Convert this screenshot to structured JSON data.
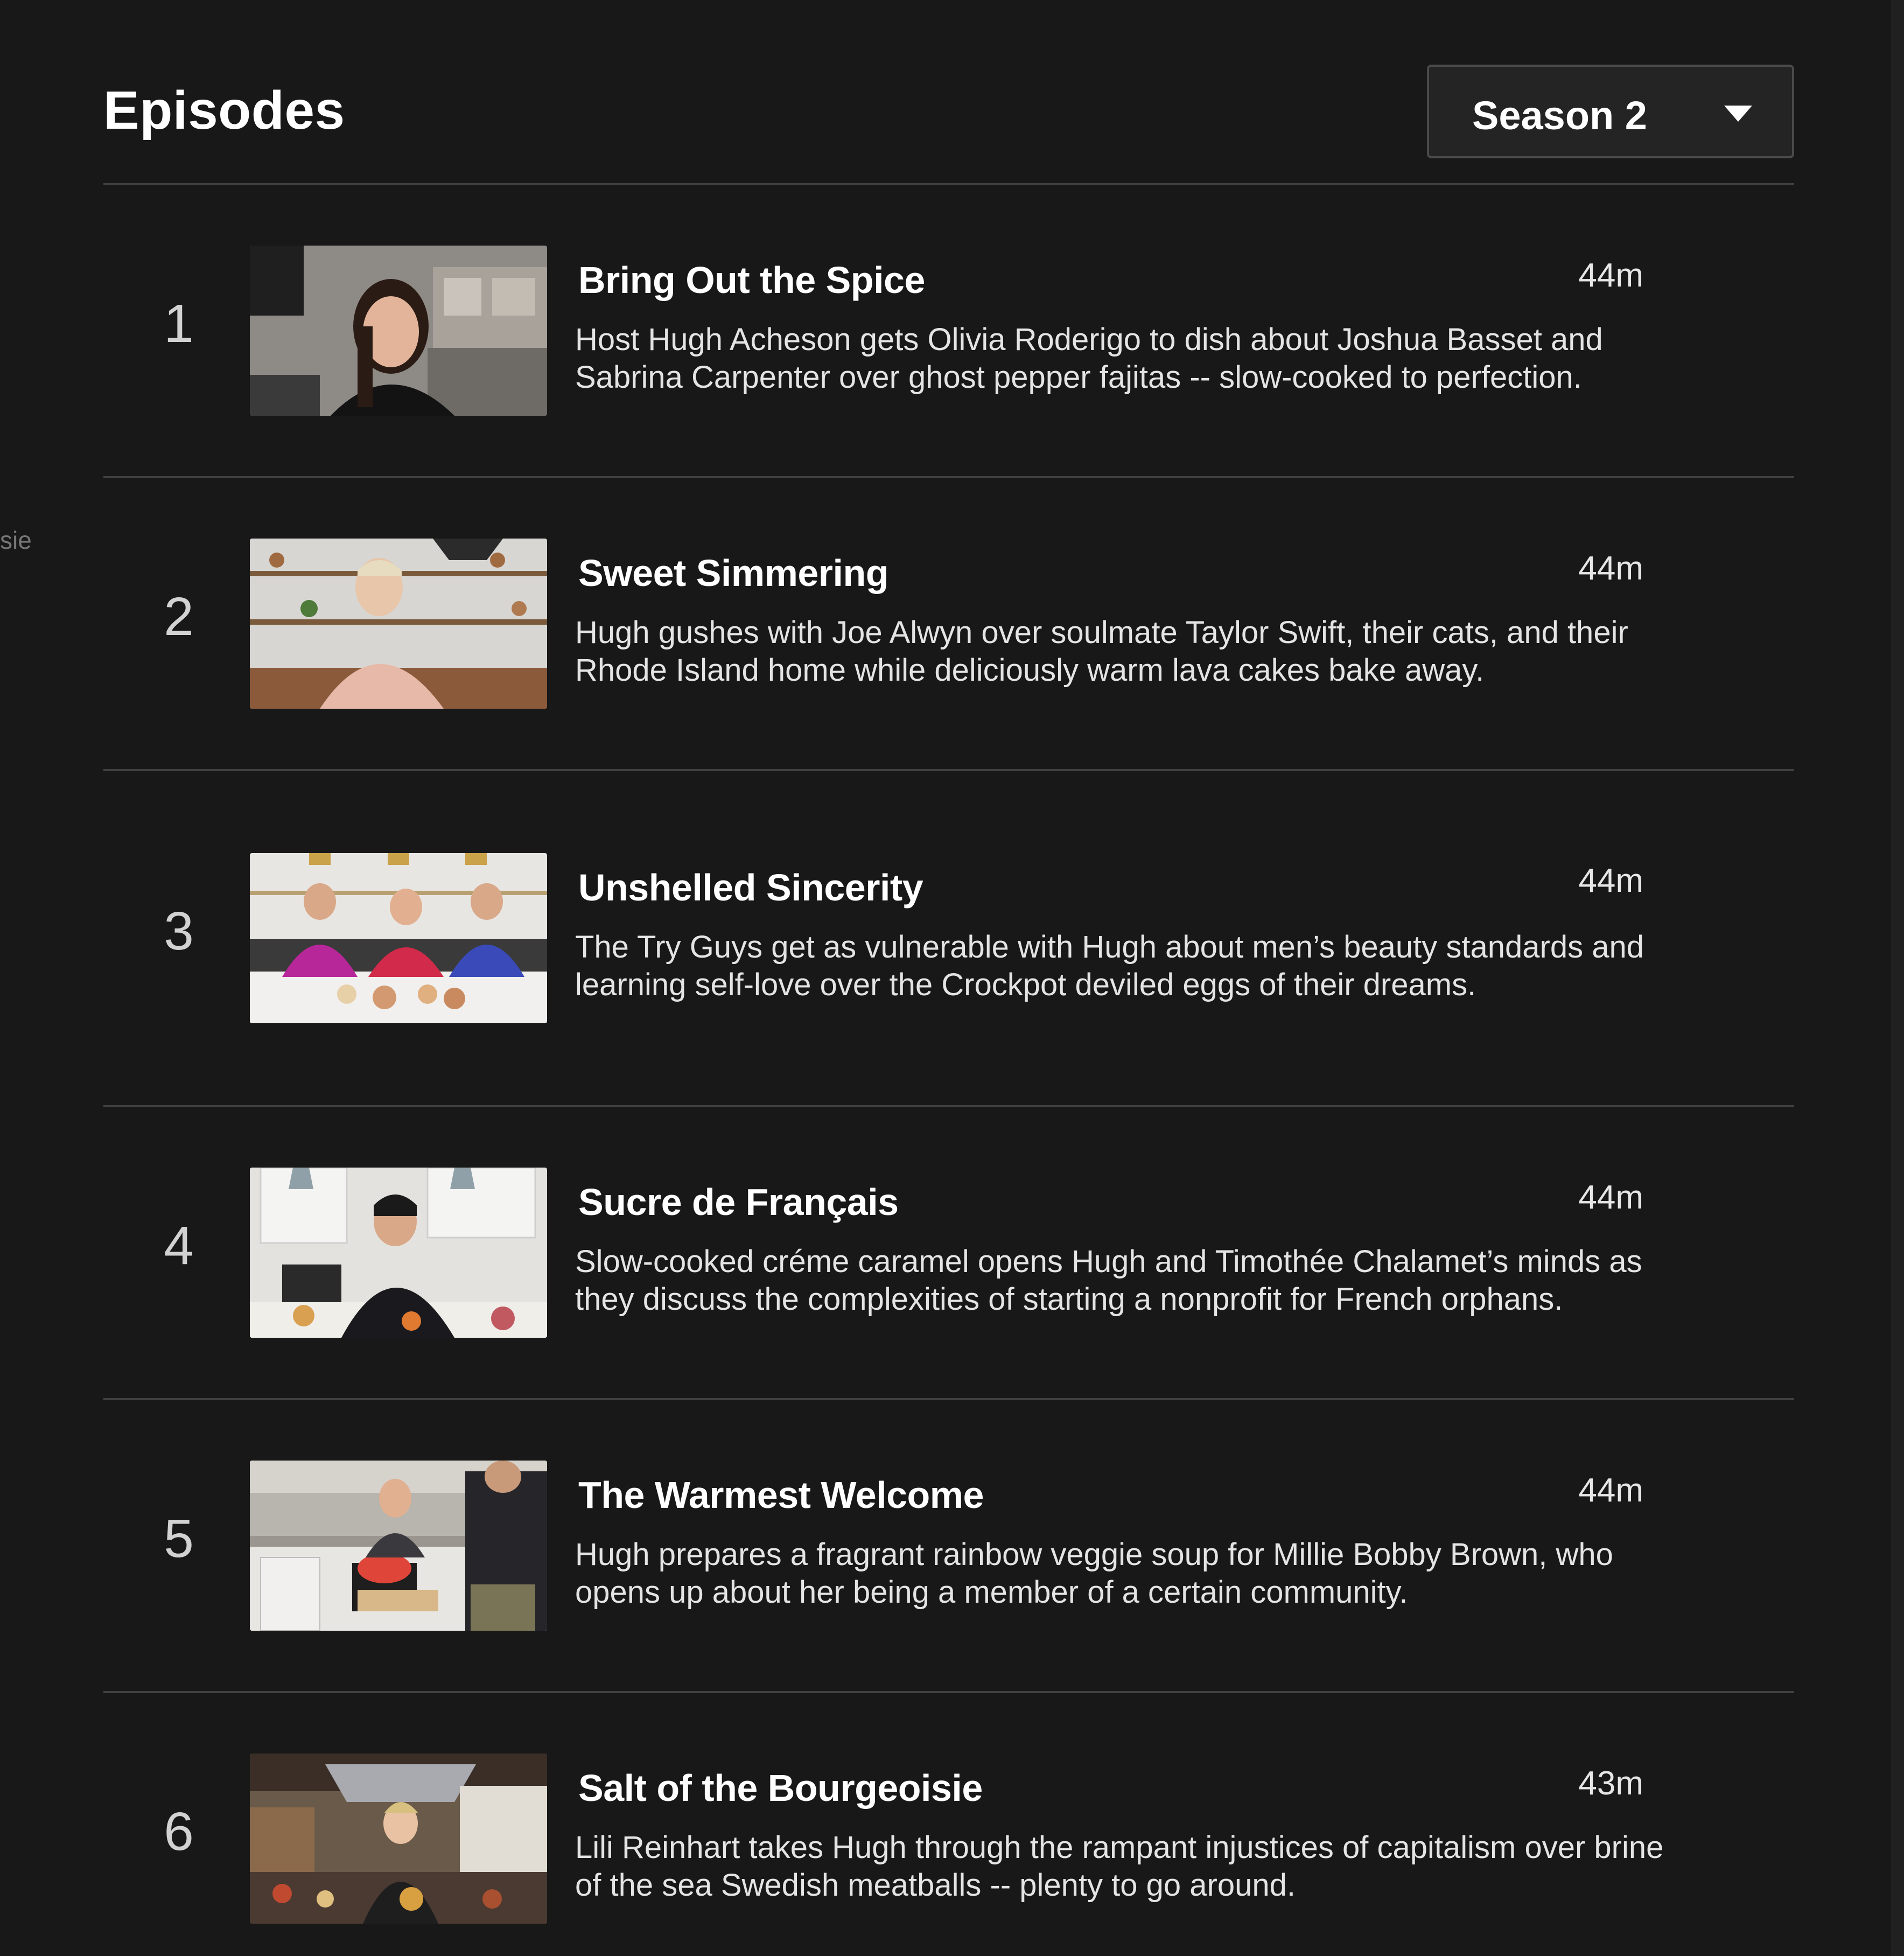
{
  "header": {
    "title": "Episodes",
    "season_selected": "Season 2"
  },
  "side_fragment": "sie",
  "episodes": [
    {
      "index": "1",
      "title": "Bring Out the Spice",
      "duration": "44m",
      "description": "Host Hugh Acheson gets Olivia Roderigo to dish about Joshua Basset and Sabrina Carpenter over ghost pepper fajitas -- slow-cooked to perfection."
    },
    {
      "index": "2",
      "title": "Sweet Simmering",
      "duration": "44m",
      "description": "Hugh gushes with Joe Alwyn over soulmate Taylor Swift, their cats, and their Rhode Island home while deliciously warm lava cakes bake away."
    },
    {
      "index": "3",
      "title": "Unshelled Sincerity",
      "duration": "44m",
      "description": "The Try Guys get as vulnerable with Hugh about men’s beauty standards and learning self-love over the Crockpot deviled eggs of their dreams."
    },
    {
      "index": "4",
      "title": "Sucre de Français",
      "duration": "44m",
      "description": "Slow-cooked créme caramel opens Hugh and Timothée Chalamet’s minds as they discuss the complexities of starting a nonprofit for French orphans."
    },
    {
      "index": "5",
      "title": "The Warmest Welcome",
      "duration": "44m",
      "description": "Hugh prepares a fragrant rainbow veggie soup for Millie Bobby Brown, who opens up about her being a member of a certain community."
    },
    {
      "index": "6",
      "title": "Salt of the Bourgeoisie",
      "duration": "43m",
      "description": "Lili Reinhart takes Hugh through the rampant injustices of capitalism over brine of the sea Swedish meatballs -- plenty to go around."
    }
  ]
}
